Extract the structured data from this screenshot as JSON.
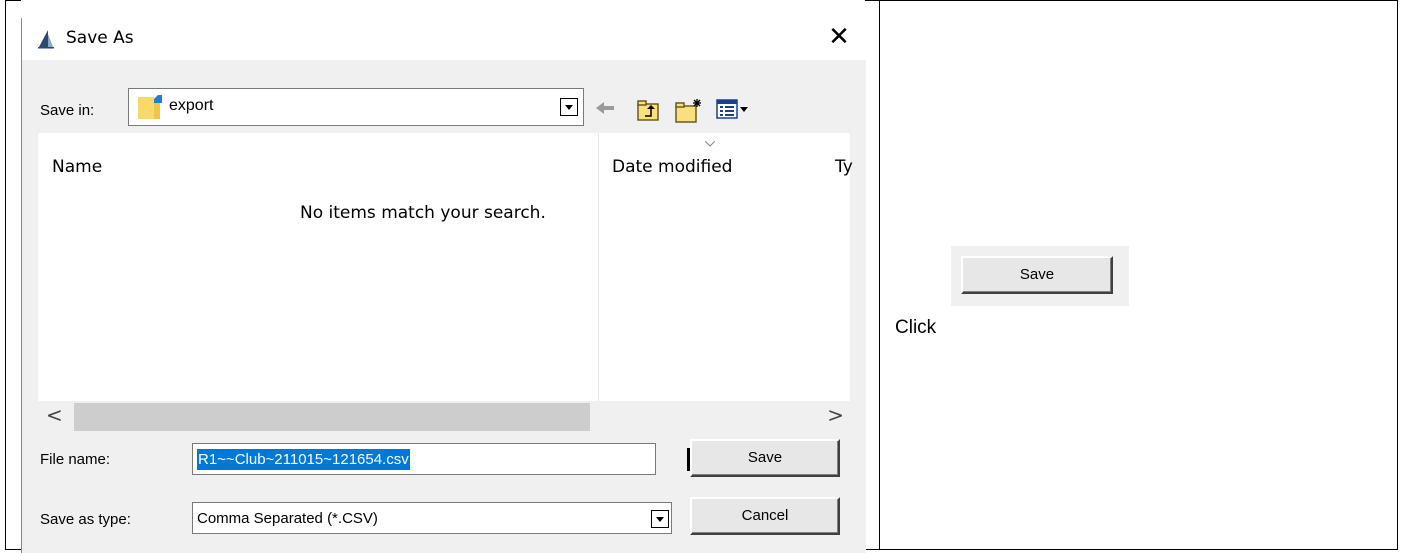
{
  "dialog": {
    "title": "Save As",
    "close_glyph": "✕",
    "save_in": {
      "label": "Save in:",
      "value": "export"
    },
    "toolbar": {
      "icons": [
        "back-arrow-icon",
        "up-one-level-icon",
        "new-folder-icon",
        "views-menu-icon"
      ]
    },
    "file_list": {
      "columns": [
        "Name",
        "Date modified",
        "Ty"
      ],
      "empty_message": "No items match your search."
    },
    "scrollbar": {
      "left_glyph": "<",
      "right_glyph": ">"
    },
    "file_name": {
      "label": "File name:",
      "value": "R1~~Club~211015~121654.csv"
    },
    "save_as_type": {
      "label": "Save as type:",
      "value": "Comma Separated (*.CSV)"
    },
    "buttons": {
      "save": "Save",
      "cancel": "Cancel"
    }
  },
  "instruction": {
    "text": "Click",
    "button_label": "Save"
  },
  "colors": {
    "selection": "#0078d7",
    "dialog_bg": "#f0f0f0",
    "folder": "#f4c542"
  }
}
